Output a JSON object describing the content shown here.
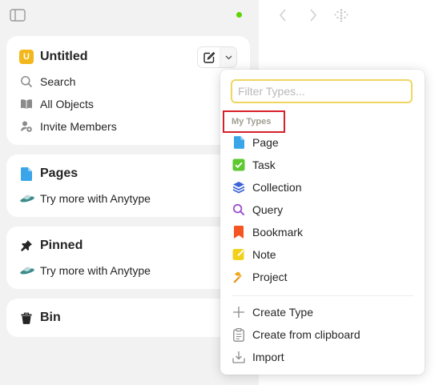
{
  "sidebar": {
    "space": {
      "avatar_letter": "U",
      "name": "Untitled",
      "menu": {
        "search": "Search",
        "all_objects": "All Objects",
        "invite_members": "Invite Members"
      }
    },
    "widgets": {
      "pages": {
        "title": "Pages",
        "hint": "Try more with Anytype"
      },
      "pinned": {
        "title": "Pinned",
        "hint": "Try more with Anytype"
      },
      "bin": {
        "title": "Bin"
      }
    },
    "status_color": "#5dd400"
  },
  "dropdown": {
    "filter_placeholder": "Filter Types...",
    "section_label": "My Types",
    "types": [
      {
        "label": "Page",
        "icon": "page-icon"
      },
      {
        "label": "Task",
        "icon": "task-checkbox-icon"
      },
      {
        "label": "Collection",
        "icon": "collection-stack-icon"
      },
      {
        "label": "Query",
        "icon": "query-search-icon"
      },
      {
        "label": "Bookmark",
        "icon": "bookmark-icon"
      },
      {
        "label": "Note",
        "icon": "note-icon"
      },
      {
        "label": "Project",
        "icon": "hammer-icon"
      }
    ],
    "actions": [
      {
        "label": "Create Type",
        "icon": "plus-icon"
      },
      {
        "label": "Create from clipboard",
        "icon": "clipboard-icon"
      },
      {
        "label": "Import",
        "icon": "import-icon"
      }
    ]
  },
  "colors": {
    "accent_yellow": "#f0d660",
    "highlight_red": "#d9202a",
    "space_avatar": "#f2b71c"
  }
}
